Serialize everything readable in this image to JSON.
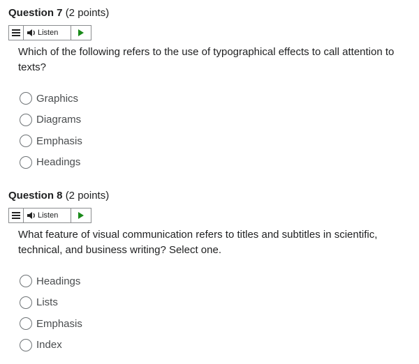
{
  "questions": [
    {
      "title": "Question 7",
      "points": "(2 points)",
      "listen_label": "Listen",
      "text": "Which of the following refers to the use of typographical effects to call attention to texts?",
      "options": [
        "Graphics",
        "Diagrams",
        "Emphasis",
        "Headings"
      ]
    },
    {
      "title": "Question 8",
      "points": "(2 points)",
      "listen_label": "Listen",
      "text": "What feature of visual communication refers to titles and subtitles in scientific, technical, and business writing? Select one.",
      "options": [
        "Headings",
        "Lists",
        "Emphasis",
        "Index"
      ]
    }
  ],
  "icons": {
    "menu": "menu-icon",
    "speaker": "speaker-icon",
    "play": "play-icon"
  },
  "colors": {
    "play_green": "#1a8a1a",
    "text": "#202122",
    "option_text": "#494c4e",
    "border": "#8a8c8f"
  }
}
